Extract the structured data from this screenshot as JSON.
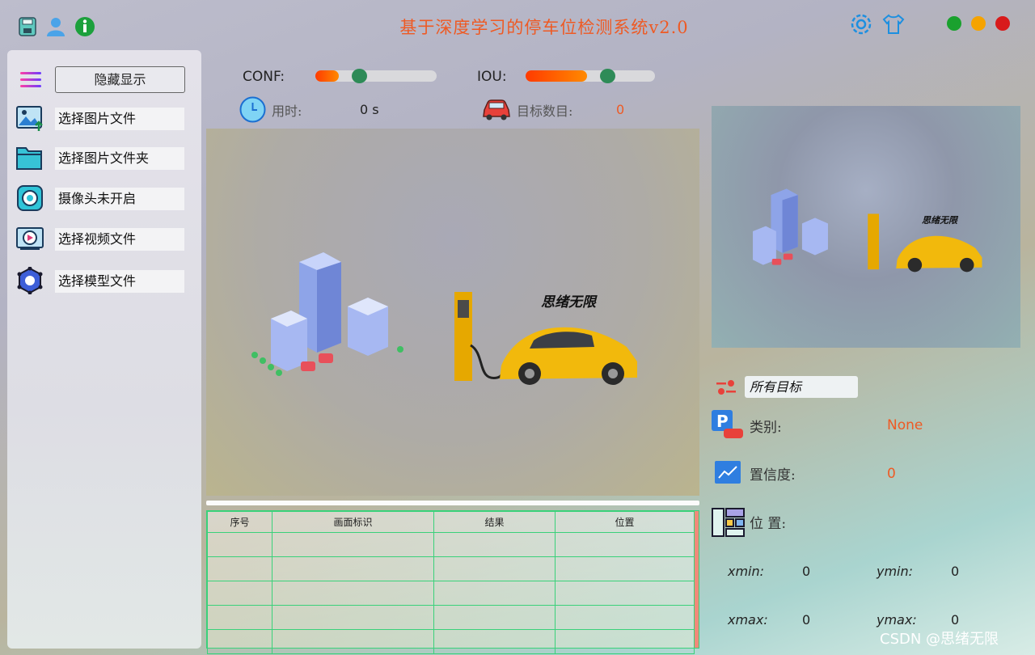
{
  "window": {
    "title": "基于深度学习的停车位检测系统v2.0",
    "controls": {
      "colors": [
        "#1aa12e",
        "#f5a300",
        "#d81b1b"
      ]
    }
  },
  "sidebar": {
    "toggle_label": "隐藏显示",
    "items": [
      {
        "label": "选择图片文件",
        "icon": "image-upload-icon"
      },
      {
        "label": "选择图片文件夹",
        "icon": "folder-icon"
      },
      {
        "label": "摄像头未开启",
        "icon": "camera-icon"
      },
      {
        "label": "选择视频文件",
        "icon": "video-icon"
      },
      {
        "label": "选择模型文件",
        "icon": "model-icon"
      }
    ]
  },
  "controls": {
    "conf_label": "CONF:",
    "conf_value": 0.25,
    "iou_label": "IOU:",
    "iou_value": 0.5
  },
  "stats": {
    "time_label": "用时:",
    "time_value": "0 s",
    "count_label": "目标数目:",
    "count_value": "0"
  },
  "image": {
    "watermark_text": "思绪无限"
  },
  "table": {
    "headers": [
      "序号",
      "画面标识",
      "结果",
      "位置"
    ],
    "rows": [
      [
        "",
        "",
        "",
        ""
      ],
      [
        "",
        "",
        "",
        ""
      ],
      [
        "",
        "",
        "",
        ""
      ],
      [
        "",
        "",
        "",
        ""
      ],
      [
        "",
        "",
        "",
        ""
      ]
    ]
  },
  "detail": {
    "target_select": "所有目标",
    "class_label": "类别:",
    "class_value": "None",
    "conf_label": "置信度:",
    "conf_value": "0",
    "pos_label": "位 置:",
    "xmin_label": "xmin:",
    "xmin": "0",
    "ymin_label": "ymin:",
    "ymin": "0",
    "xmax_label": "xmax:",
    "xmax": "0",
    "ymax_label": "ymax:",
    "ymax": "0"
  },
  "footer": {
    "watermark": "CSDN @思绪无限"
  },
  "colors": {
    "accent": "#ee5a24",
    "slider_knob": "#2e8b57",
    "table_border": "#3ad17a"
  }
}
